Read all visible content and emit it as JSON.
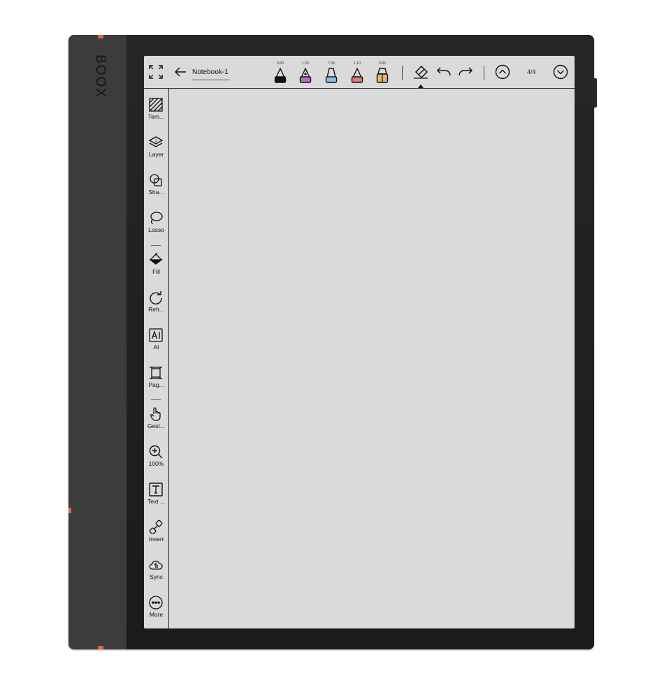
{
  "device": {
    "brand": "BOOX",
    "accent_color": "#e0643e"
  },
  "toolbar": {
    "fullscreen_icon": "fullscreen-icon",
    "back_icon": "arrow-left-icon",
    "notebook_title": "Notebook-1",
    "pens": [
      {
        "width": "0.80",
        "icon": "fountain-pen-icon",
        "color": "#111111"
      },
      {
        "width": "1.20",
        "icon": "pen-icon",
        "color": "#b86bc2"
      },
      {
        "width": "7.05",
        "icon": "marker-icon",
        "color": "#8ec0e0"
      },
      {
        "width": "1.10",
        "icon": "pencil-icon",
        "color": "#e07a7a"
      },
      {
        "width": "9.80",
        "icon": "brush-icon",
        "color": "#e6b27a"
      }
    ],
    "eraser_icon": "eraser-icon",
    "undo_icon": "undo-icon",
    "redo_icon": "redo-icon",
    "prev_page_icon": "chevron-up-circle-icon",
    "page_indicator": "4/4",
    "next_page_icon": "chevron-down-circle-icon"
  },
  "sidebar": {
    "items": [
      {
        "label": "Tem...",
        "icon": "template-icon"
      },
      {
        "label": "Layer",
        "icon": "layers-icon"
      },
      {
        "label": "Sha...",
        "icon": "shapes-icon"
      },
      {
        "label": "Lasso",
        "icon": "lasso-icon"
      },
      {
        "label": "Fill",
        "icon": "fill-bucket-icon"
      },
      {
        "label": "Refr...",
        "icon": "refresh-icon"
      },
      {
        "label": "AI",
        "icon": "ai-icon"
      },
      {
        "label": "Pag...",
        "icon": "page-icon"
      },
      {
        "label": "Gest...",
        "icon": "gesture-hand-icon"
      },
      {
        "label": "100%",
        "icon": "zoom-in-icon"
      },
      {
        "label": "Text ...",
        "icon": "text-box-icon"
      },
      {
        "label": "Insert",
        "icon": "link-insert-icon"
      },
      {
        "label": "Sync",
        "icon": "cloud-sync-icon"
      },
      {
        "label": "More",
        "icon": "more-icon"
      }
    ]
  }
}
